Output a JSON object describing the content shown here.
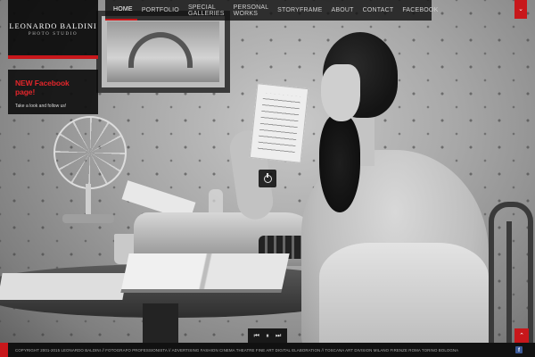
{
  "brand": {
    "name": "LEONARDO BALDINI",
    "subtitle": "PHOTO STUDIO"
  },
  "nav": {
    "items": [
      {
        "label": "HOME",
        "active": true
      },
      {
        "label": "PORTFOLIO",
        "active": false
      },
      {
        "label": "SPECIAL GALLERIES",
        "active": false
      },
      {
        "label": "PERSONAL WORKS",
        "active": false
      },
      {
        "label": "STORYFRAME",
        "active": false
      },
      {
        "label": "ABOUT",
        "active": false
      },
      {
        "label": "CONTACT",
        "active": false
      },
      {
        "label": "FACEBOOK",
        "active": false
      }
    ]
  },
  "promo": {
    "title": "NEW Facebook page!",
    "text": "Take a look and follow us!"
  },
  "controls": {
    "corner_icon": "chevron-down-icon",
    "center_icon": "power-icon",
    "player": [
      {
        "name": "previous-icon",
        "glyph": "⏮"
      },
      {
        "name": "pause-icon",
        "glyph": "⏸"
      },
      {
        "name": "next-icon",
        "glyph": "⏭"
      }
    ],
    "up_icon": "chevron-up-icon"
  },
  "footer": {
    "copyright": "COPYRIGHT 2001-2015 LEONARDO BALDINI // FOTOGRAFO PROFESSIONISTA // ADVERTISING FASHION CINEMA THEATRE FINE ART DIGITAL ELABORATION // TOSCANA ART DIVISION MILANO FIRENZE ROMA TORINO BOLOGNA",
    "social_icon": "facebook-icon"
  },
  "colors": {
    "accent": "#c8171b",
    "panel": "#111111",
    "facebook": "#3b5998"
  }
}
